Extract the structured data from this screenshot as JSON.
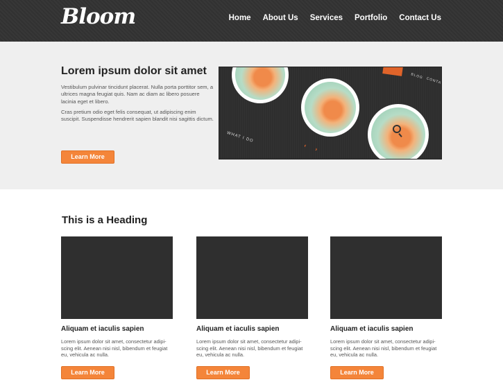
{
  "header": {
    "logo": "Bloom",
    "nav": [
      "Home",
      "About Us",
      "Services",
      "Portfolio",
      "Contact Us"
    ]
  },
  "hero": {
    "title": "Lorem ipsum dolor sit amet",
    "paragraph1": "Vestibulum pulvinar tincidunt placerat. Nulla porta porttitor sem, a ultrices magna feugiat quis. Nam ac diam ac libero posuere lacinia eget et libero.",
    "paragraph2": "Cras pretium odio eget felis consequat, ut adipiscing enim suscipit. Suspendisse hendrerit sapien blandit nisi sagittis dictum.",
    "button": "Learn More",
    "image": {
      "caption": "WHAT I DO",
      "nav_blog": "BLOG",
      "nav_contact": "CONTACT",
      "arrows": "‹ ›"
    }
  },
  "section": {
    "heading": "This is a Heading",
    "cards": [
      {
        "title": "Aliquam et iaculis sapien",
        "text": "Lorem ipsum dolor sit amet, consectetur adipi-scing elit. Aenean nisi nisl, bibendum et feugiat eu, vehicula ac nulla.",
        "button": "Learn More"
      },
      {
        "title": "Aliquam et iaculis sapien",
        "text": "Lorem ipsum dolor sit amet, consectetur adipi-scing elit. Aenean nisi nisl, bibendum et feugiat eu, vehicula ac nulla.",
        "button": "Learn More"
      },
      {
        "title": "Aliquam et iaculis sapien",
        "text": "Lorem ipsum dolor sit amet, consectetur adipi-scing elit. Aenean nisi nisl, bibendum et feugiat eu, vehicula ac nulla.",
        "button": "Learn More"
      }
    ]
  },
  "colors": {
    "header_bg": "#333333",
    "hero_bg": "#efefef",
    "accent": "#f4853a",
    "placeholder": "#2f2f2f"
  }
}
